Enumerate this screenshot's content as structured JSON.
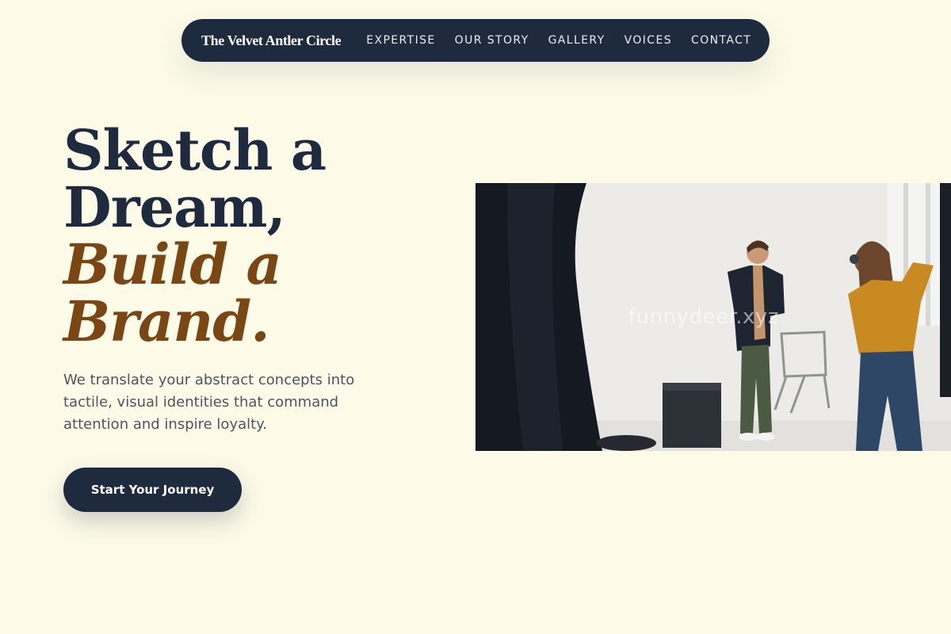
{
  "nav": {
    "brand": "The Velvet Antler Circle",
    "links": [
      "EXPERTISE",
      "OUR STORY",
      "GALLERY",
      "VOICES",
      "CONTACT"
    ]
  },
  "hero": {
    "headline_line1": "Sketch a",
    "headline_line2": "Dream,",
    "headline_accent_line1": "Build a",
    "headline_accent_line2": "Brand.",
    "description": "We translate your abstract concepts into tactile, visual identities that command attention and inspire loyalty.",
    "cta_label": "Start Your Journey",
    "image_watermark": "funnydeer.xyz"
  },
  "colors": {
    "background": "#fdfbe8",
    "navy": "#1e2a3e",
    "accent_brown": "#7a4614",
    "body_text": "#4e5460"
  },
  "image": {
    "subject": "photo-studio-shoot",
    "description_icon": "photo-image"
  }
}
